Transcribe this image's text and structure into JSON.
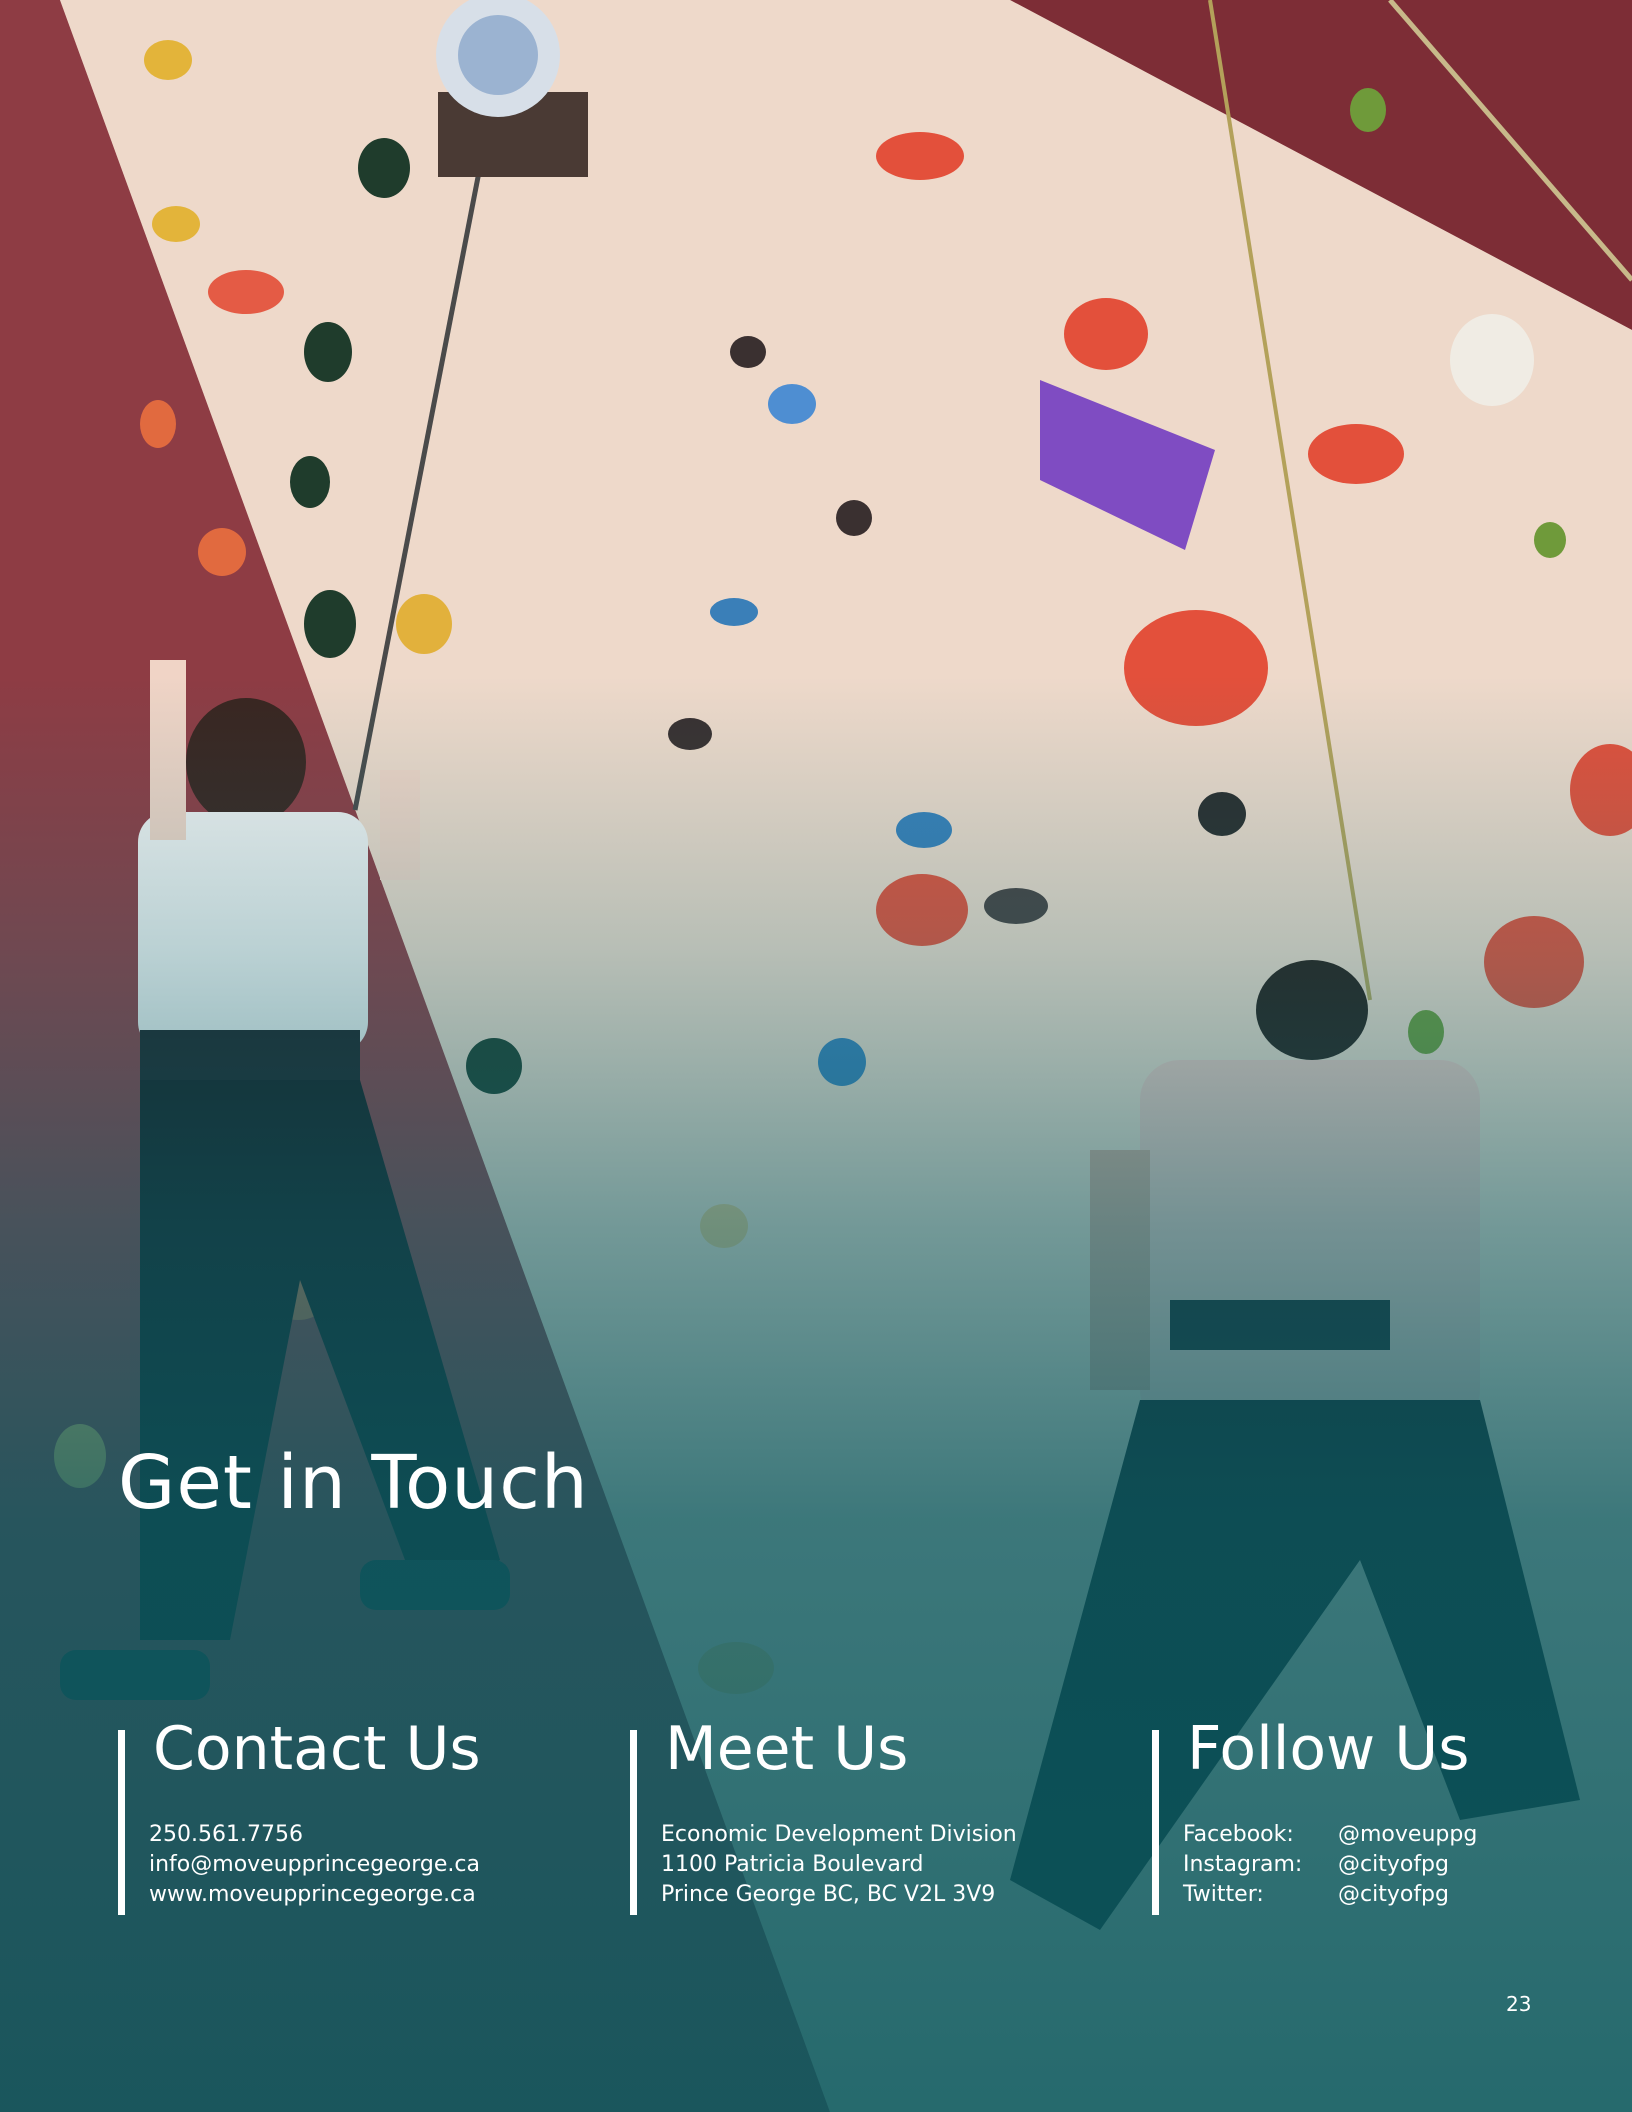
{
  "headline": "Get in Touch",
  "contact": {
    "heading": "Contact Us",
    "phone": "250.561.7756",
    "email": "info@moveupprincegeorge.ca",
    "website": "www.moveupprincegeorge.ca"
  },
  "meet": {
    "heading": "Meet Us",
    "line1": "Economic Development Division",
    "line2": "1100 Patricia Boulevard",
    "line3": "Prince George BC, BC V2L 3V9"
  },
  "follow": {
    "heading": "Follow Us",
    "items": [
      {
        "platform": "Facebook:",
        "handle": "@moveuppg"
      },
      {
        "platform": "Instagram:",
        "handle": "@cityofpg"
      },
      {
        "platform": "Twitter:",
        "handle": "@cityofpg"
      }
    ]
  },
  "page_number": "23",
  "colors": {
    "wall": "#ecd6c6",
    "wall_panel_red": "#8e3c44",
    "overlay_teal": "#0e6470",
    "text": "#ffffff"
  }
}
